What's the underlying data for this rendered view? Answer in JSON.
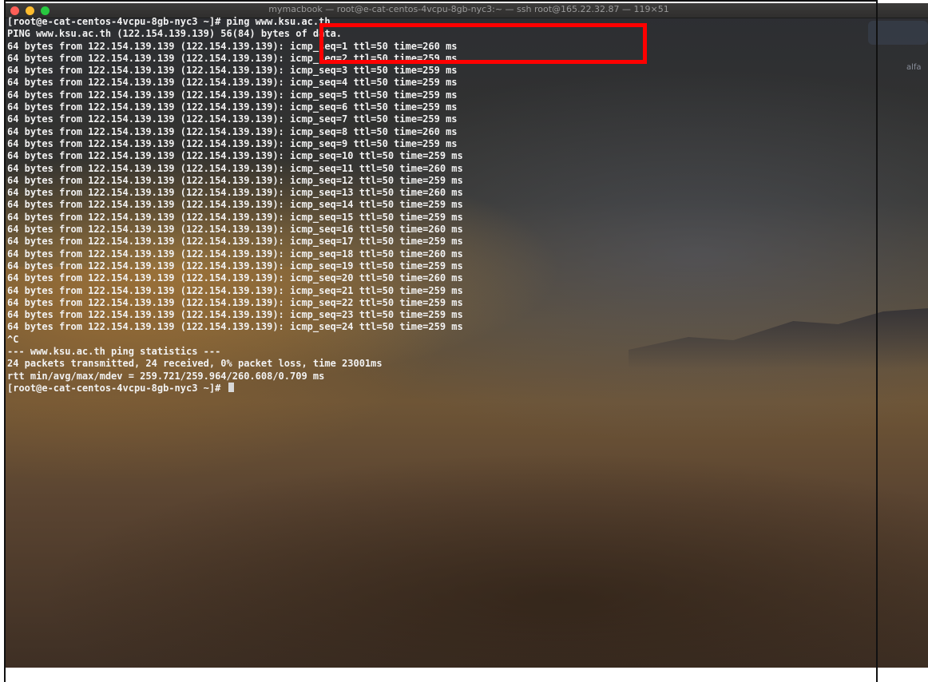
{
  "window": {
    "title": "mymacbook — root@e-cat-centos-4vcpu-8gb-nyc3:~ — ssh root@165.22.32.87 — 119×51"
  },
  "desktop": {
    "side_label": "alfa"
  },
  "terminal": {
    "lines": [
      "[root@e-cat-centos-4vcpu-8gb-nyc3 ~]# ping www.ksu.ac.th",
      "PING www.ksu.ac.th (122.154.139.139) 56(84) bytes of data.",
      "64 bytes from 122.154.139.139 (122.154.139.139): icmp_seq=1 ttl=50 time=260 ms",
      "64 bytes from 122.154.139.139 (122.154.139.139): icmp_seq=2 ttl=50 time=259 ms",
      "64 bytes from 122.154.139.139 (122.154.139.139): icmp_seq=3 ttl=50 time=259 ms",
      "64 bytes from 122.154.139.139 (122.154.139.139): icmp_seq=4 ttl=50 time=259 ms",
      "64 bytes from 122.154.139.139 (122.154.139.139): icmp_seq=5 ttl=50 time=259 ms",
      "64 bytes from 122.154.139.139 (122.154.139.139): icmp_seq=6 ttl=50 time=259 ms",
      "64 bytes from 122.154.139.139 (122.154.139.139): icmp_seq=7 ttl=50 time=259 ms",
      "64 bytes from 122.154.139.139 (122.154.139.139): icmp_seq=8 ttl=50 time=260 ms",
      "64 bytes from 122.154.139.139 (122.154.139.139): icmp_seq=9 ttl=50 time=259 ms",
      "64 bytes from 122.154.139.139 (122.154.139.139): icmp_seq=10 ttl=50 time=259 ms",
      "64 bytes from 122.154.139.139 (122.154.139.139): icmp_seq=11 ttl=50 time=260 ms",
      "64 bytes from 122.154.139.139 (122.154.139.139): icmp_seq=12 ttl=50 time=259 ms",
      "64 bytes from 122.154.139.139 (122.154.139.139): icmp_seq=13 ttl=50 time=260 ms",
      "64 bytes from 122.154.139.139 (122.154.139.139): icmp_seq=14 ttl=50 time=259 ms",
      "64 bytes from 122.154.139.139 (122.154.139.139): icmp_seq=15 ttl=50 time=259 ms",
      "64 bytes from 122.154.139.139 (122.154.139.139): icmp_seq=16 ttl=50 time=260 ms",
      "64 bytes from 122.154.139.139 (122.154.139.139): icmp_seq=17 ttl=50 time=259 ms",
      "64 bytes from 122.154.139.139 (122.154.139.139): icmp_seq=18 ttl=50 time=260 ms",
      "64 bytes from 122.154.139.139 (122.154.139.139): icmp_seq=19 ttl=50 time=259 ms",
      "64 bytes from 122.154.139.139 (122.154.139.139): icmp_seq=20 ttl=50 time=260 ms",
      "64 bytes from 122.154.139.139 (122.154.139.139): icmp_seq=21 ttl=50 time=259 ms",
      "64 bytes from 122.154.139.139 (122.154.139.139): icmp_seq=22 ttl=50 time=259 ms",
      "64 bytes from 122.154.139.139 (122.154.139.139): icmp_seq=23 ttl=50 time=259 ms",
      "64 bytes from 122.154.139.139 (122.154.139.139): icmp_seq=24 ttl=50 time=259 ms",
      "^C",
      "--- www.ksu.ac.th ping statistics ---",
      "24 packets transmitted, 24 received, 0% packet loss, time 23001ms",
      "rtt min/avg/max/mdev = 259.721/259.964/260.608/0.709 ms"
    ],
    "prompt": "[root@e-cat-centos-4vcpu-8gb-nyc3 ~]# "
  },
  "colors": {
    "highlight_box": "#ff0000",
    "terminal_text": "#f2f2f2"
  }
}
